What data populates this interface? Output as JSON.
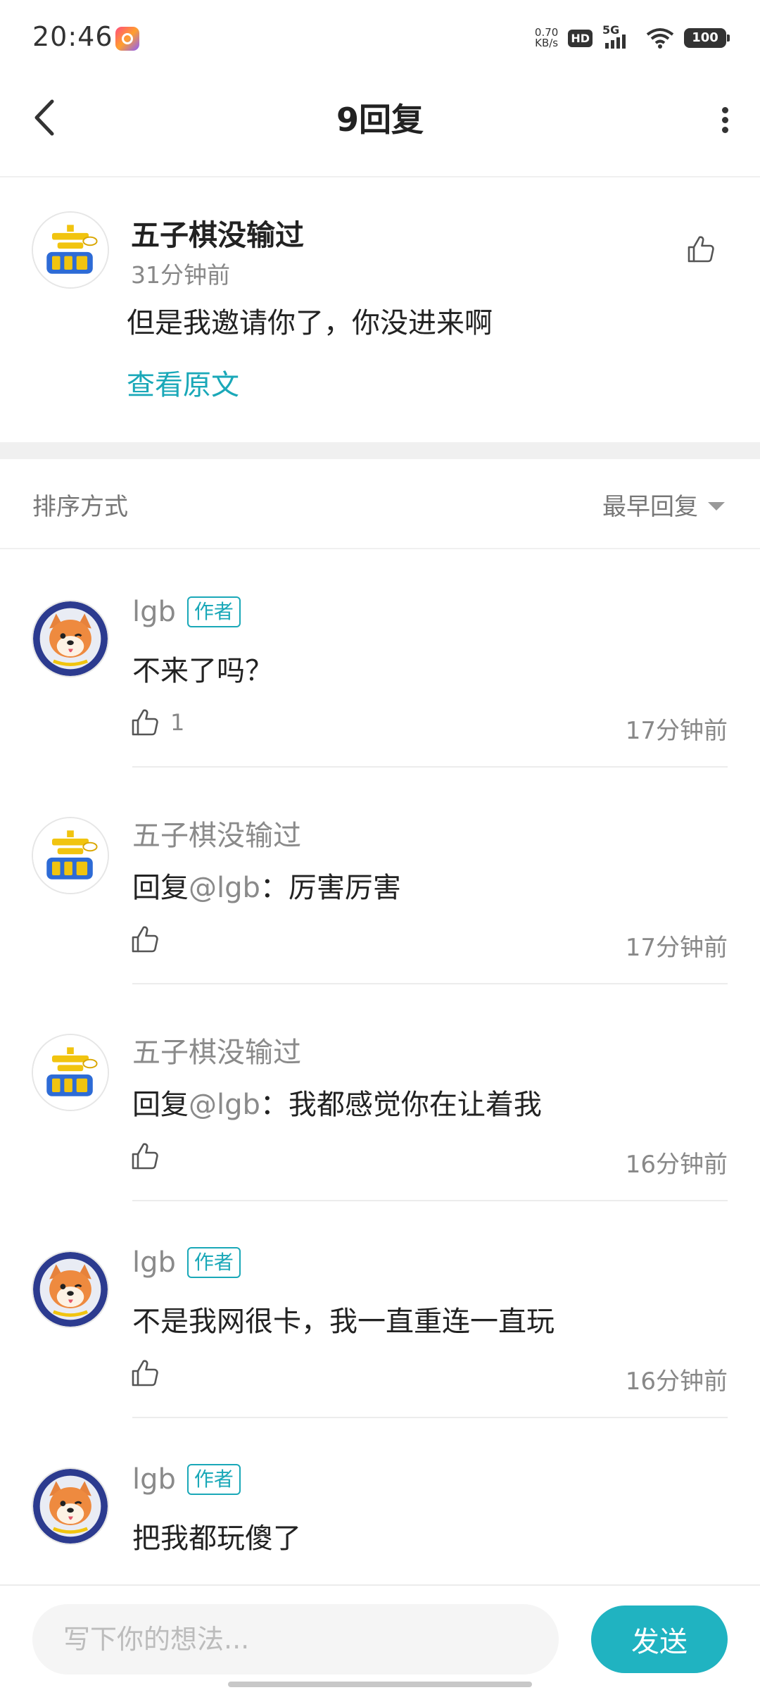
{
  "status_bar": {
    "time": "20:46",
    "net_speed_value": "0.70",
    "net_speed_unit": "KB/s",
    "hd": "HD",
    "network": "5G",
    "battery": "100"
  },
  "header": {
    "title": "9回复",
    "back_icon": "chevron-left-icon",
    "more_icon": "more-vertical-icon"
  },
  "original_post": {
    "author": "五子棋没输过",
    "time": "31分钟前",
    "text": "但是我邀请你了，你没进来啊",
    "view_original": "查看原文"
  },
  "sort": {
    "label": "排序方式",
    "selected": "最早回复"
  },
  "replies": [
    {
      "author": "lgb",
      "tag": "作者",
      "text": "不来了吗？",
      "likes": "1",
      "time": "17分钟前",
      "avatar": "shiba-dog"
    },
    {
      "author": "五子棋没输过",
      "reply_prefix": "回复",
      "reply_to": "@lgb",
      "text": "：厉害厉害",
      "time": "17分钟前",
      "avatar": "win-text"
    },
    {
      "author": "五子棋没输过",
      "reply_prefix": "回复",
      "reply_to": "@lgb",
      "text": "：我都感觉你在让着我",
      "time": "16分钟前",
      "avatar": "win-text"
    },
    {
      "author": "lgb",
      "tag": "作者",
      "text": "不是我网很卡，我一直重连一直玩",
      "time": "16分钟前",
      "avatar": "shiba-dog"
    },
    {
      "author": "lgb",
      "tag": "作者",
      "text": "把我都玩傻了",
      "avatar": "shiba-dog"
    }
  ],
  "composer": {
    "placeholder": "写下你的想法...",
    "send_label": "发送"
  },
  "colors": {
    "accent": "#1aa8b8",
    "send_button": "#20b3c1"
  }
}
